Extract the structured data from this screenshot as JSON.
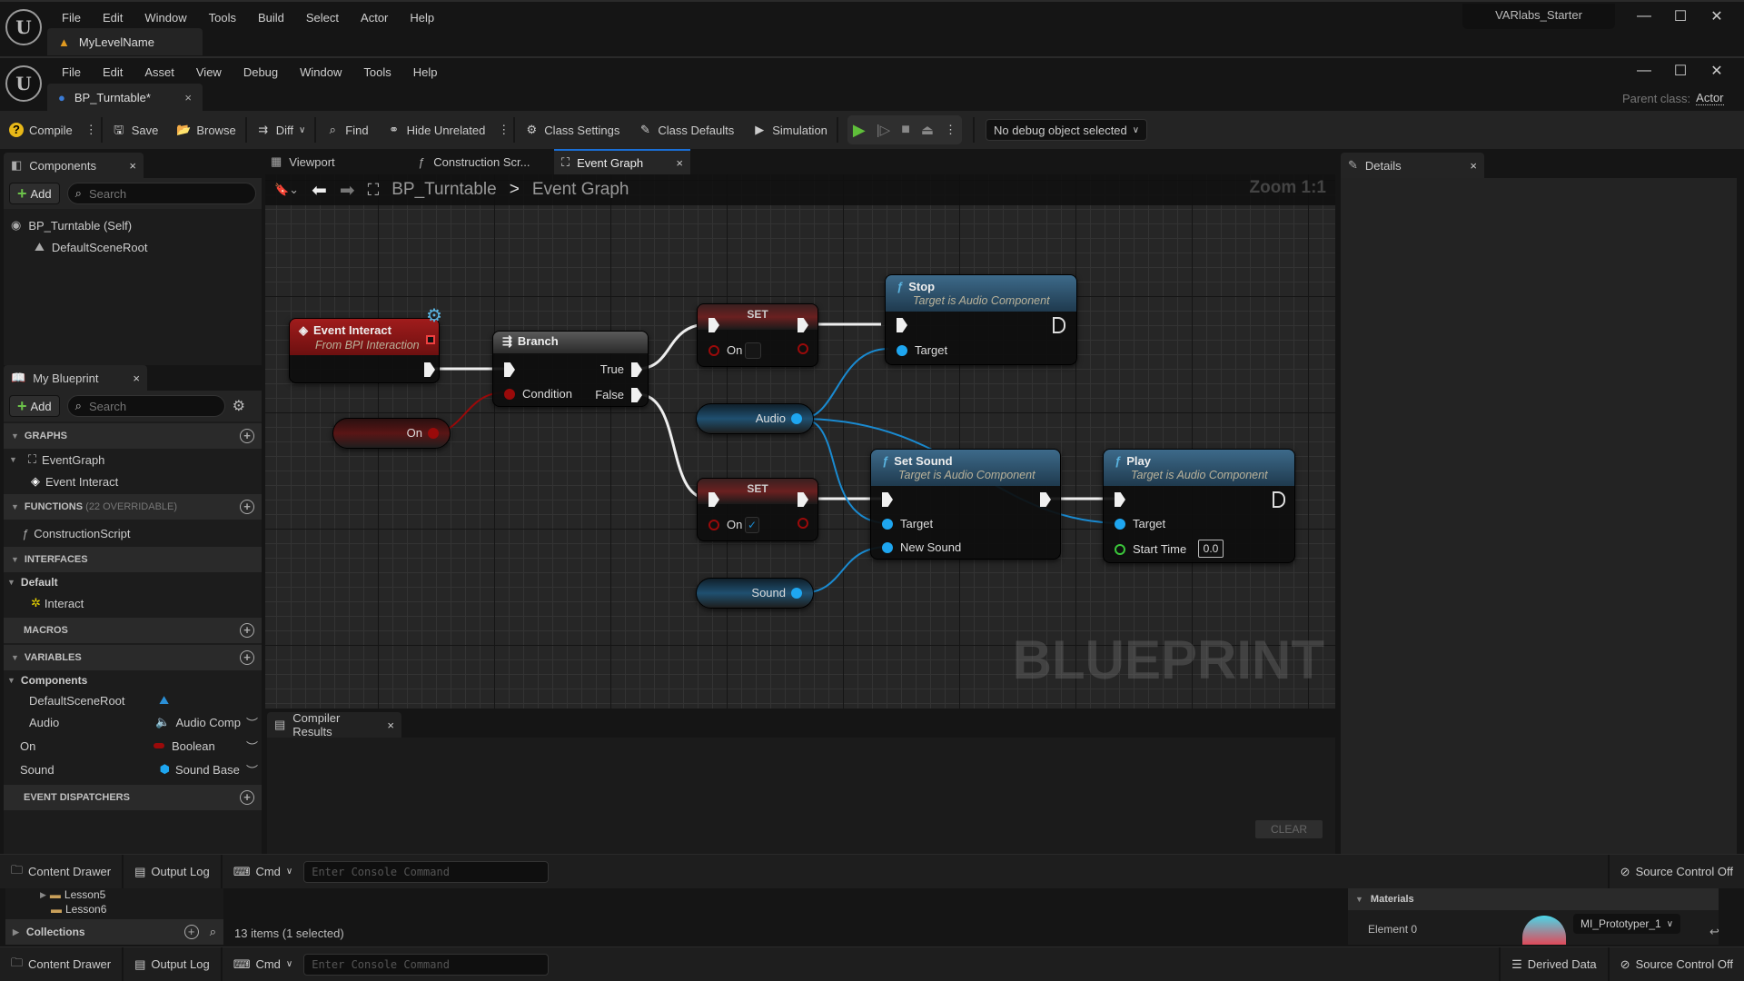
{
  "outer_window": {
    "menu": [
      "File",
      "Edit",
      "Window",
      "Tools",
      "Build",
      "Select",
      "Actor",
      "Help"
    ],
    "level_tab": "MyLevelName",
    "project_name": "VARlabs_Starter"
  },
  "bp_window": {
    "menu": [
      "File",
      "Edit",
      "Asset",
      "View",
      "Debug",
      "Window",
      "Tools",
      "Help"
    ],
    "asset_tab": "BP_Turntable*",
    "parent_class_label": "Parent class:",
    "parent_class_value": "Actor"
  },
  "toolbar": {
    "compile": "Compile",
    "save": "Save",
    "browse": "Browse",
    "diff": "Diff",
    "find": "Find",
    "hide_unrelated": "Hide Unrelated",
    "class_settings": "Class Settings",
    "class_defaults": "Class Defaults",
    "simulation": "Simulation",
    "debug_object": "No debug object selected"
  },
  "components_panel": {
    "title": "Components",
    "add": "Add",
    "search_placeholder": "Search",
    "tree": [
      {
        "label": "BP_Turntable (Self)",
        "icon": "actor-icon"
      },
      {
        "label": "DefaultSceneRoot",
        "icon": "scene-component-icon"
      }
    ]
  },
  "my_blueprint": {
    "title": "My Blueprint",
    "add": "Add",
    "search_placeholder": "Search",
    "sections": {
      "graphs": "GRAPHS",
      "functions": "FUNCTIONS",
      "functions_note": "(22 OVERRIDABLE)",
      "interfaces": "INTERFACES",
      "macros": "MACROS",
      "variables": "VARIABLES",
      "event_dispatchers": "EVENT DISPATCHERS"
    },
    "graphs": [
      {
        "label": "EventGraph"
      },
      {
        "label": "Event Interact"
      }
    ],
    "functions": [
      {
        "label": "ConstructionScript"
      }
    ],
    "interfaces": {
      "category": "Default",
      "items": [
        {
          "label": "Interact"
        }
      ]
    },
    "variables": {
      "category": "Components",
      "items": [
        {
          "name": "DefaultSceneRoot",
          "type": "",
          "color": "#2b8fd6"
        },
        {
          "name": "Audio",
          "type": "Audio Comp",
          "color": "#1ea6f0"
        },
        {
          "name": "On",
          "type": "Boolean",
          "color": "#9a0a0a"
        },
        {
          "name": "Sound",
          "type": "Sound Base",
          "color": "#1ea6f0"
        }
      ]
    }
  },
  "editor_tabs": [
    {
      "label": "Viewport"
    },
    {
      "label": "Construction Scr..."
    },
    {
      "label": "Event Graph",
      "active": true
    }
  ],
  "graph": {
    "breadcrumb": [
      "BP_Turntable",
      "Event Graph"
    ],
    "zoom": "Zoom 1:1",
    "watermark": "BLUEPRINT",
    "nodes": {
      "event_interact": {
        "title": "Event Interact",
        "subtitle": "From BPI Interaction"
      },
      "branch": {
        "title": "Branch",
        "condition": "Condition",
        "true": "True",
        "false": "False"
      },
      "get_on": {
        "label": "On"
      },
      "set_top": {
        "title": "SET",
        "pin": "On",
        "checked": false
      },
      "set_bottom": {
        "title": "SET",
        "pin": "On",
        "checked": true
      },
      "get_audio": {
        "label": "Audio"
      },
      "get_sound": {
        "label": "Sound"
      },
      "stop": {
        "title": "Stop",
        "subtitle": "Target is Audio Component",
        "target": "Target"
      },
      "set_sound": {
        "title": "Set Sound",
        "subtitle": "Target is Audio Component",
        "target": "Target",
        "new_sound": "New Sound"
      },
      "play": {
        "title": "Play",
        "subtitle": "Target is Audio Component",
        "target": "Target",
        "start_time": "Start Time",
        "start_time_value": "0.0"
      }
    },
    "colors": {
      "exec": "#f0f0f0",
      "bool": "#9a0a0a",
      "object": "#1ea6f0",
      "float": "#3bc73b"
    }
  },
  "compiler_results": {
    "title": "Compiler Results",
    "clear": "CLEAR"
  },
  "details_panel": {
    "title": "Details"
  },
  "bottom_bar": {
    "content_drawer": "Content Drawer",
    "output_log": "Output Log",
    "cmd": "Cmd",
    "console_placeholder": "Enter Console Command",
    "source_control": "Source Control Off",
    "derived_data": "Derived Data"
  },
  "content_browser": {
    "folders": [
      "Lesson5",
      "Lesson6"
    ],
    "collections": "Collections",
    "status": "13 items (1 selected)"
  },
  "materials_panel": {
    "section": "Materials",
    "element_label": "Element 0",
    "material": "MI_Prototyper_1"
  }
}
